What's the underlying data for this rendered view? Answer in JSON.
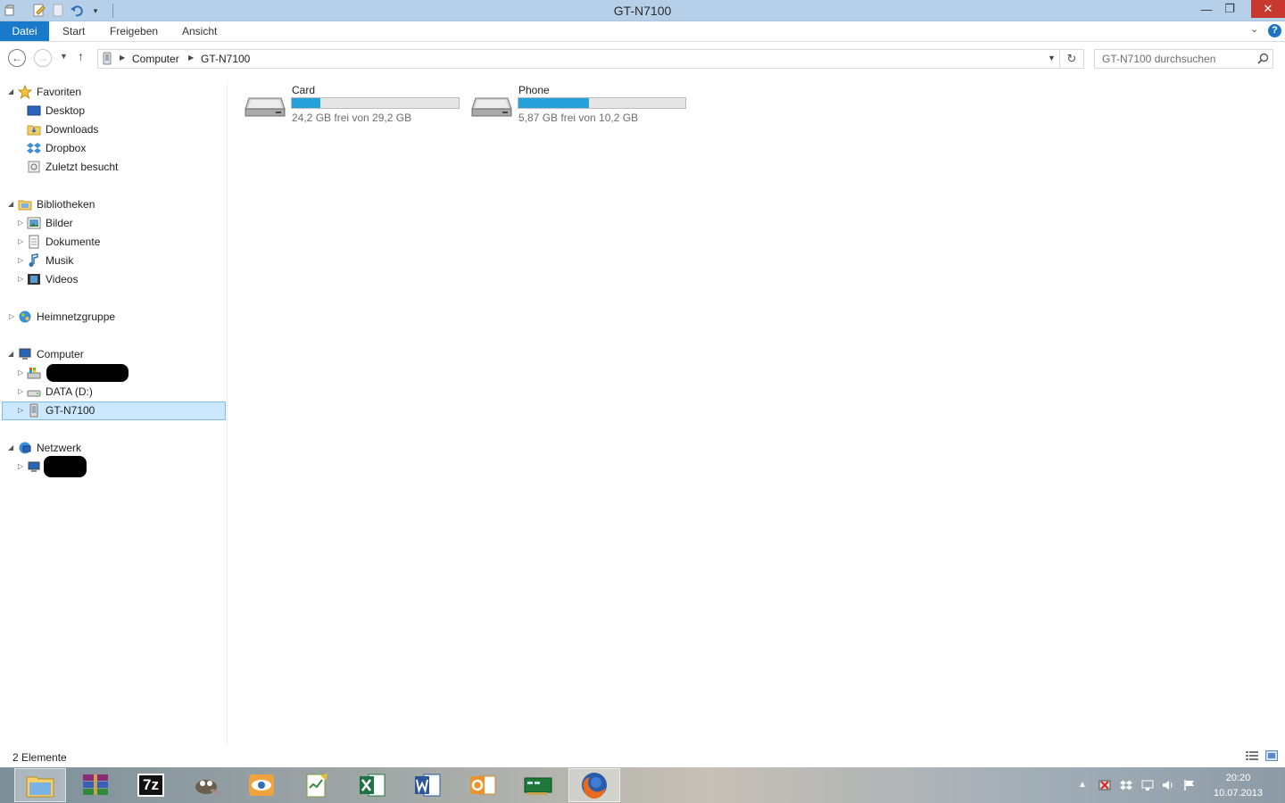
{
  "window": {
    "title": "GT-N7100",
    "minimize": "—",
    "maximize": "❐",
    "close": "✕"
  },
  "ribbon": {
    "tabs": [
      "Datei",
      "Start",
      "Freigeben",
      "Ansicht"
    ],
    "expand": "⌄",
    "help": "?"
  },
  "address": {
    "crumbs": [
      "Computer",
      "GT-N7100"
    ],
    "refresh": "↻",
    "dropdown": "▼"
  },
  "search": {
    "placeholder": "GT-N7100 durchsuchen"
  },
  "navpane": {
    "favorites": {
      "label": "Favoriten",
      "items": [
        "Desktop",
        "Downloads",
        "Dropbox",
        "Zuletzt besucht"
      ]
    },
    "libraries": {
      "label": "Bibliotheken",
      "items": [
        "Bilder",
        "Dokumente",
        "Musik",
        "Videos"
      ]
    },
    "homegroup": {
      "label": "Heimnetzgruppe"
    },
    "computer": {
      "label": "Computer",
      "items": [
        "DATA (D:)",
        "GT-N7100"
      ]
    },
    "network": {
      "label": "Netzwerk"
    }
  },
  "drives": [
    {
      "name": "Card",
      "info": "24,2 GB frei von 29,2 GB",
      "used_fraction": 0.171
    },
    {
      "name": "Phone",
      "info": "5,87 GB frei von 10,2 GB",
      "used_fraction": 0.425
    }
  ],
  "status": {
    "count": "2 Elemente"
  },
  "taskbar": {
    "apps": [
      "explorer-icon",
      "winrar-icon",
      "7zip-icon",
      "gimp-icon",
      "eye-icon",
      "notepad-icon",
      "excel-icon",
      "word-icon",
      "outlook-icon",
      "network-card-icon",
      "firefox-icon"
    ],
    "sevenzip_label": "7z",
    "time": "20:20",
    "date": "10.07.2013"
  },
  "colors": {
    "accent": "#1979ca",
    "drive_bar": "#26a0da",
    "selection": "#cce8ff"
  }
}
